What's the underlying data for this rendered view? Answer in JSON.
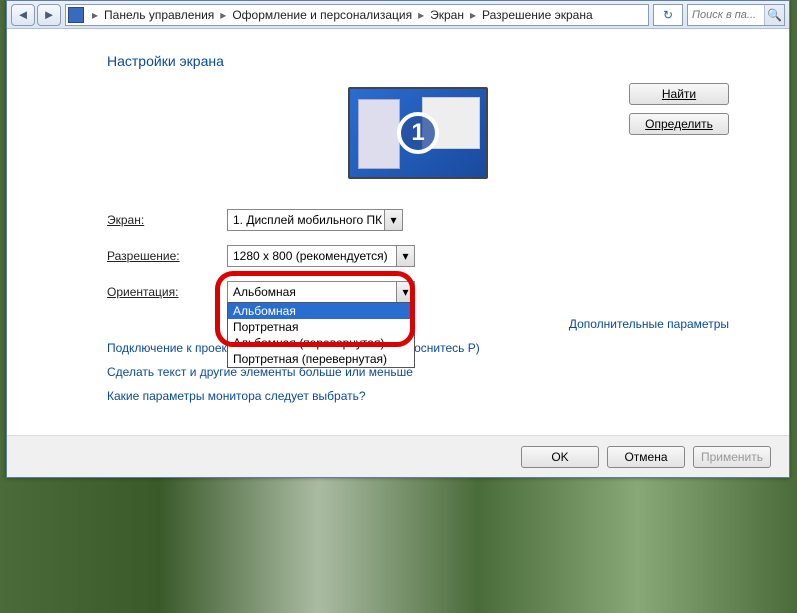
{
  "breadcrumb": {
    "items": [
      "Панель управления",
      "Оформление и персонализация",
      "Экран",
      "Разрешение экрана"
    ]
  },
  "search": {
    "placeholder": "Поиск в па..."
  },
  "title": "Настройки экрана",
  "monitor_number": "1",
  "buttons": {
    "find": "Найти",
    "identify": "Определить",
    "ok": "OK",
    "cancel": "Отмена",
    "apply": "Применить"
  },
  "labels": {
    "display": "Экран:",
    "resolution": "Разрешение:",
    "orientation": "Ориентация:"
  },
  "values": {
    "display": "1. Дисплей мобильного ПК",
    "resolution": "1280 x 800 (рекомендуется)",
    "orientation": "Альбомная"
  },
  "orientation_options": [
    "Альбомная",
    "Портретная",
    "Альбомная (перевернутая)",
    "Портретная (перевернутая)"
  ],
  "orientation_selected_index": 0,
  "links": {
    "advanced": "Дополнительные параметры",
    "projector": "Подключение к проектору (или нажмите клавишу ⊞ и коснитесь P)",
    "textsize": "Сделать текст и другие элементы больше или меньше",
    "which": "Какие параметры монитора следует выбрать?"
  }
}
